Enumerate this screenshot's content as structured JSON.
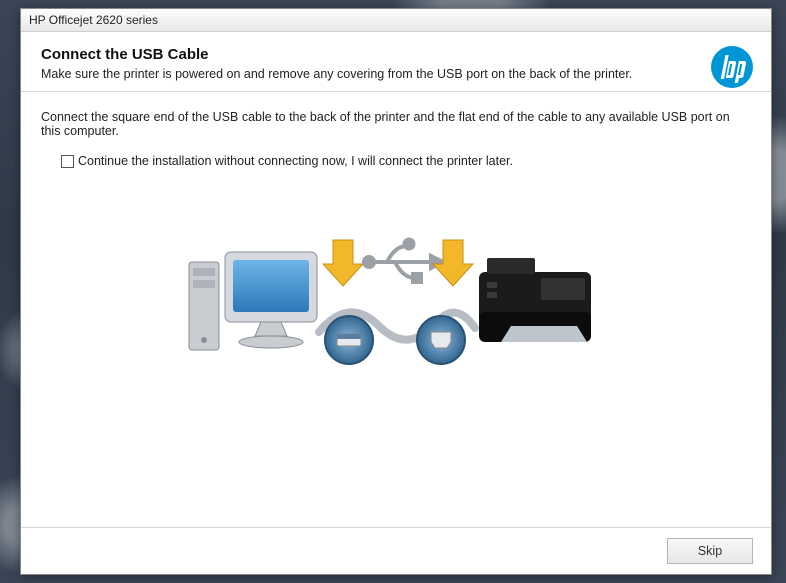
{
  "window": {
    "title": "HP Officejet 2620 series"
  },
  "header": {
    "heading": "Connect the USB Cable",
    "subheading": "Make sure the printer is powered on and remove any covering from the USB port on the back of the printer."
  },
  "body": {
    "instruction": "Connect the square end of the USB cable to the back of the printer and the flat end of the cable to any available USB port on this computer."
  },
  "checkbox": {
    "label": "Continue the installation without connecting now, I will connect the printer later.",
    "checked": false
  },
  "footer": {
    "skip_label": "Skip"
  },
  "brand": {
    "logo_color": "#0096D6",
    "logo_text": "hp"
  }
}
